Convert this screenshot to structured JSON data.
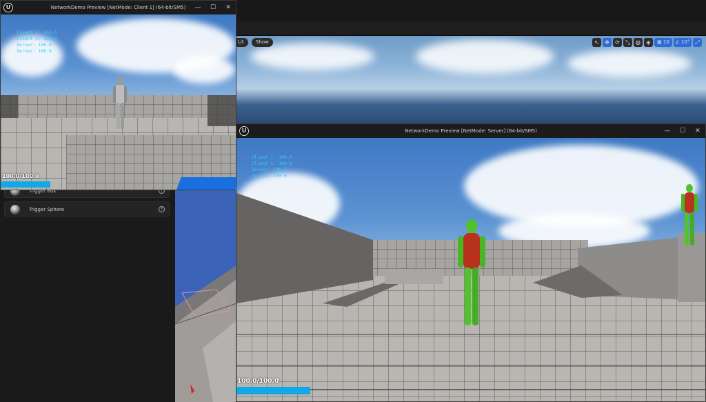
{
  "editor": {
    "lit_label": "Lit",
    "show_label": "Show",
    "grid_snap": "10",
    "rotation_snap": "10°",
    "place_items": [
      "Trigger Box",
      "Trigger Sphere"
    ]
  },
  "client_window": {
    "title": "NetworkDemo Preview [NetMode: Client 1]  (64-bit/SM5)",
    "stats": [
      "Client 1: 100.0",
      "Client 1: 100.0",
      "Server: 100.0",
      "Server: 100.0"
    ],
    "health_text": "100.0/100.0",
    "health_fraction": 1.0
  },
  "server_window": {
    "title": "NetworkDemo Preview [NetMode: Server]  (64-bit/SM5)",
    "stats": [
      "Client 1: 100.0",
      "Client 1: 100.0",
      "Server: 100.0",
      "Server: 100.0"
    ],
    "health_text": "100.0/100.0",
    "health_fraction": 1.0
  },
  "window_controls": {
    "minimize": "—",
    "maximize": "☐",
    "close": "✕"
  },
  "colors": {
    "hud_text": "#2ed0ff",
    "health_bar": "#12a8e8",
    "accent": "#2f6bd6"
  }
}
